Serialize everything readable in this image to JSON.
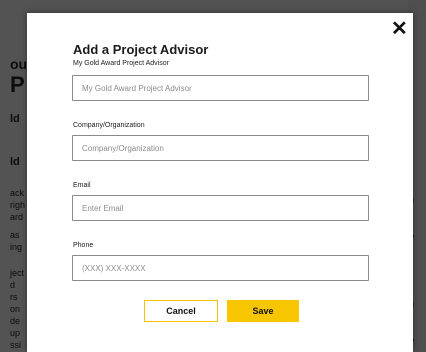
{
  "background": {
    "left_fragments": [
      "ou",
      "P",
      "ld",
      "ld",
      "ack",
      "righ",
      "ard",
      "as",
      "ing",
      "ject",
      "d",
      "rs",
      "on",
      "de",
      "up",
      "ssi"
    ],
    "right_fragments": [
      "e",
      "e",
      "e",
      "e"
    ]
  },
  "modal": {
    "close_label": "✕",
    "title": "Add a Project Advisor",
    "fields": [
      {
        "label": "My Gold Award Project Advisor",
        "value": "",
        "placeholder": "My Gold Award Project Advisor"
      },
      {
        "label": "Company/Organization",
        "value": "",
        "placeholder": "Company/Organization"
      },
      {
        "label": "Email",
        "value": "",
        "placeholder": "Enter Email"
      },
      {
        "label": "Phone",
        "value": "",
        "placeholder": "(XXX) XXX-XXXX"
      }
    ],
    "cancel_label": "Cancel",
    "save_label": "Save"
  },
  "colors": {
    "accent": "#f7c600",
    "overlay": "#000000"
  }
}
